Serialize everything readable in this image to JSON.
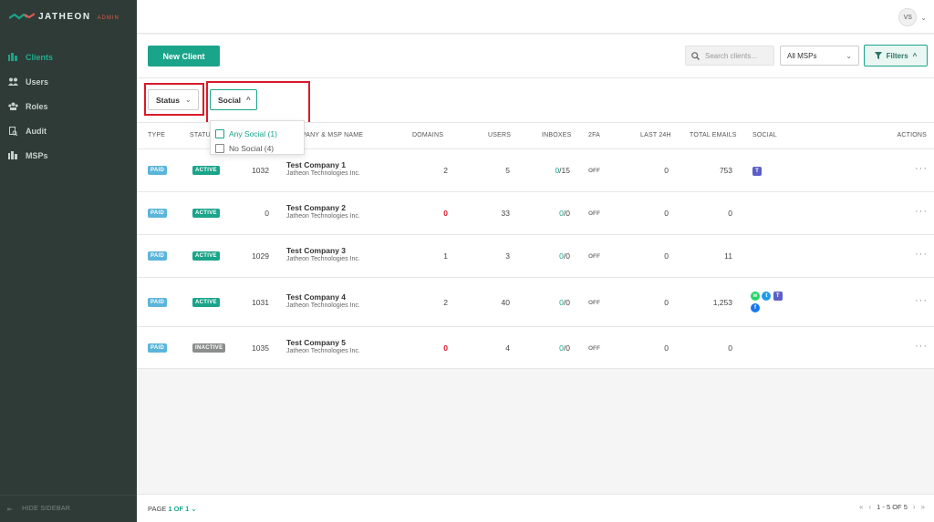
{
  "app": {
    "brand": "JATHEON",
    "brand_suffix": "ADMIN",
    "user_initials": "VS"
  },
  "sidebar": {
    "items": [
      {
        "label": "Clients",
        "icon": "clients-icon",
        "active": true
      },
      {
        "label": "Users",
        "icon": "users-icon",
        "active": false
      },
      {
        "label": "Roles",
        "icon": "roles-icon",
        "active": false
      },
      {
        "label": "Audit",
        "icon": "audit-icon",
        "active": false
      },
      {
        "label": "MSPs",
        "icon": "msps-icon",
        "active": false
      }
    ],
    "hide_label": "HIDE SIDEBAR"
  },
  "toolbar": {
    "new_client_label": "New Client",
    "search_placeholder": "Search clients...",
    "msp_select_value": "All MSPs",
    "filters_label": "Filters"
  },
  "filters": {
    "status_label": "Status",
    "social_label": "Social",
    "social_options": [
      {
        "label": "Any Social (1)"
      },
      {
        "label": "No Social (4)"
      }
    ]
  },
  "table": {
    "headers": {
      "type": "TYPE",
      "status": "STATUS",
      "company": "COMPANY & MSP NAME",
      "domains": "DOMAINS",
      "users": "USERS",
      "inboxes": "INBOXES",
      "twofa": "2FA",
      "last24": "LAST 24H",
      "total_emails": "TOTAL EMAILS",
      "social": "SOCIAL",
      "actions": "ACTIONS"
    },
    "rows": [
      {
        "type": "PAID",
        "status": "ACTIVE",
        "id": "1032",
        "name": "Test Company 1",
        "msp": "Jatheon Technologies Inc.",
        "domains": "2",
        "domains_zero": false,
        "users": "5",
        "inboxes_used": "0",
        "inboxes_total": "/15",
        "twofa": "OFF",
        "last24": "0",
        "total_emails": "753",
        "social": [
          "teams"
        ]
      },
      {
        "type": "PAID",
        "status": "ACTIVE",
        "id": "0",
        "name": "Test Company 2",
        "msp": "Jatheon Technologies Inc.",
        "domains": "0",
        "domains_zero": true,
        "users": "33",
        "inboxes_used": "0",
        "inboxes_total": "/0",
        "twofa": "OFF",
        "last24": "0",
        "total_emails": "0",
        "social": []
      },
      {
        "type": "PAID",
        "status": "ACTIVE",
        "id": "1029",
        "name": "Test Company 3",
        "msp": "Jatheon Technologies Inc.",
        "domains": "1",
        "domains_zero": false,
        "users": "3",
        "inboxes_used": "0",
        "inboxes_total": "/0",
        "twofa": "OFF",
        "last24": "0",
        "total_emails": "11",
        "social": []
      },
      {
        "type": "PAID",
        "status": "ACTIVE",
        "id": "1031",
        "name": "Test Company 4",
        "msp": "Jatheon Technologies Inc.",
        "domains": "2",
        "domains_zero": false,
        "users": "40",
        "inboxes_used": "0",
        "inboxes_total": "/0",
        "twofa": "OFF",
        "last24": "0",
        "total_emails": "1,253",
        "social": [
          "whatsapp",
          "twitter",
          "teams",
          "facebook"
        ]
      },
      {
        "type": "PAID",
        "status": "INACTIVE",
        "id": "1035",
        "name": "Test Company 5",
        "msp": "Jatheon Technologies Inc.",
        "domains": "0",
        "domains_zero": true,
        "users": "4",
        "inboxes_used": "0",
        "inboxes_total": "/0",
        "twofa": "OFF",
        "last24": "0",
        "total_emails": "0",
        "social": []
      }
    ]
  },
  "footer": {
    "page_label": "PAGE",
    "page_value": "1 OF 1",
    "range_label": "1 - 5 OF 5"
  },
  "colors": {
    "accent": "#1aa48a",
    "sidebar_bg": "#2e3b37",
    "paid": "#5bb5da",
    "inactive": "#8a8e8d",
    "highlight_red": "#d81b2a"
  }
}
